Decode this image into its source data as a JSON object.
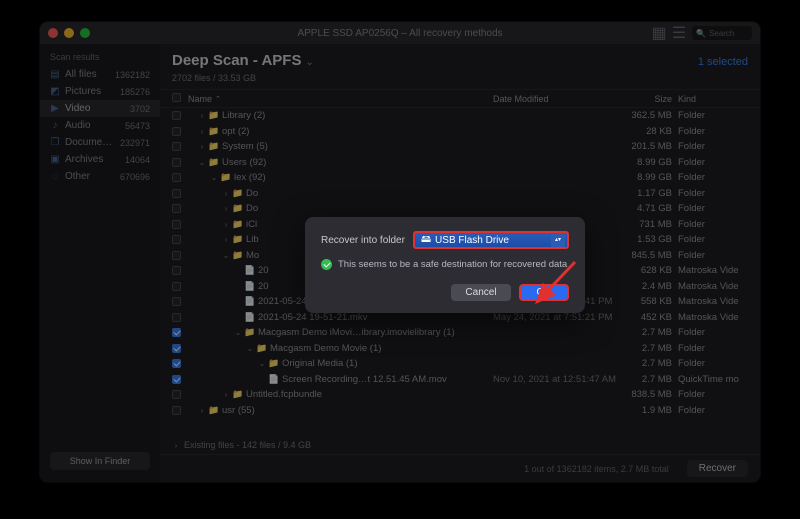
{
  "window": {
    "title": "APPLE SSD AP0256Q – All recovery methods",
    "search_placeholder": "Search"
  },
  "sidebar": {
    "header": "Scan results",
    "items": [
      {
        "icon": "files",
        "label": "All files",
        "count": "1362182"
      },
      {
        "icon": "pictures",
        "label": "Pictures",
        "count": "185276"
      },
      {
        "icon": "video",
        "label": "Video",
        "count": "3702",
        "selected": true
      },
      {
        "icon": "audio",
        "label": "Audio",
        "count": "56473"
      },
      {
        "icon": "documents",
        "label": "Documents",
        "count": "232971"
      },
      {
        "icon": "archives",
        "label": "Archives",
        "count": "14064"
      },
      {
        "icon": "other",
        "label": "Other",
        "count": "670696"
      }
    ],
    "show_in_finder": "Show In Finder"
  },
  "header": {
    "title": "Deep Scan - APFS",
    "subtitle": "2702 files / 33.53 GB",
    "selected": "1 selected"
  },
  "columns": {
    "name": "Name",
    "date": "Date Modified",
    "size": "Size",
    "kind": "Kind"
  },
  "files": [
    {
      "checked": false,
      "indent": 1,
      "disclosure": ">",
      "icon": "folder",
      "name": "Library (2)",
      "date": "",
      "size": "362.5 MB",
      "kind": "Folder"
    },
    {
      "checked": false,
      "indent": 1,
      "disclosure": ">",
      "icon": "folder",
      "name": "opt (2)",
      "date": "",
      "size": "28 KB",
      "kind": "Folder"
    },
    {
      "checked": false,
      "indent": 1,
      "disclosure": ">",
      "icon": "folder",
      "name": "System (5)",
      "date": "",
      "size": "201.5 MB",
      "kind": "Folder"
    },
    {
      "checked": false,
      "indent": 1,
      "disclosure": "v",
      "icon": "folder",
      "name": "Users (92)",
      "date": "",
      "size": "8.99 GB",
      "kind": "Folder"
    },
    {
      "checked": false,
      "indent": 2,
      "disclosure": "v",
      "icon": "folder",
      "name": "lex (92)",
      "date": "",
      "size": "8.99 GB",
      "kind": "Folder"
    },
    {
      "checked": false,
      "indent": 3,
      "disclosure": ">",
      "icon": "folder",
      "name": "Do",
      "date": "",
      "size": "1.17 GB",
      "kind": "Folder"
    },
    {
      "checked": false,
      "indent": 3,
      "disclosure": ">",
      "icon": "folder",
      "name": "Do",
      "date": "",
      "size": "4.71 GB",
      "kind": "Folder"
    },
    {
      "checked": false,
      "indent": 3,
      "disclosure": ">",
      "icon": "folder",
      "name": "iCl",
      "date": "",
      "size": "731 MB",
      "kind": "Folder"
    },
    {
      "checked": false,
      "indent": 3,
      "disclosure": ">",
      "icon": "folder",
      "name": "Lib",
      "date": "",
      "size": "1.53 GB",
      "kind": "Folder"
    },
    {
      "checked": false,
      "indent": 3,
      "disclosure": "v",
      "icon": "folder",
      "name": "Mo",
      "date": "",
      "size": "845.5 MB",
      "kind": "Folder"
    },
    {
      "checked": false,
      "indent": 4,
      "disclosure": "",
      "icon": "file",
      "name": "20",
      "date": "",
      "size": "628 KB",
      "kind": "Matroska Vide"
    },
    {
      "checked": false,
      "indent": 4,
      "disclosure": "",
      "icon": "file",
      "name": "20",
      "date": "",
      "size": "2.4 MB",
      "kind": "Matroska Vide"
    },
    {
      "checked": false,
      "indent": 4,
      "disclosure": "",
      "icon": "file",
      "name": "2021-05-24 19-47-41.mkv",
      "date": "May 24, 2021 at 7:47:41 PM",
      "size": "558 KB",
      "kind": "Matroska Vide"
    },
    {
      "checked": false,
      "indent": 4,
      "disclosure": "",
      "icon": "file",
      "name": "2021-05-24 19-51-21.mkv",
      "date": "May 24, 2021 at 7:51:21 PM",
      "size": "452 KB",
      "kind": "Matroska Vide"
    },
    {
      "checked": true,
      "indent": 4,
      "disclosure": "v",
      "icon": "folder",
      "name": "Macgasm Demo iMovi…ibrary.imovielibrary (1)",
      "date": "",
      "size": "2.7 MB",
      "kind": "Folder"
    },
    {
      "checked": true,
      "indent": 5,
      "disclosure": "v",
      "icon": "folder",
      "name": "Macgasm Demo Movie (1)",
      "date": "",
      "size": "2.7 MB",
      "kind": "Folder"
    },
    {
      "checked": true,
      "indent": 6,
      "disclosure": "v",
      "icon": "folder",
      "name": "Original Media (1)",
      "date": "",
      "size": "2.7 MB",
      "kind": "Folder"
    },
    {
      "checked": true,
      "indent": 6,
      "disclosure": "",
      "icon": "file",
      "name": "  Screen Recording…t 12.51.45 AM.mov",
      "date": "Nov 10, 2021 at 12:51:47 AM",
      "size": "2.7 MB",
      "kind": "QuickTime mo"
    },
    {
      "checked": false,
      "indent": 3,
      "disclosure": ">",
      "icon": "folder",
      "name": "Untitled.fcpbundle",
      "date": "",
      "size": "838.5 MB",
      "kind": "Folder"
    },
    {
      "checked": false,
      "indent": 1,
      "disclosure": ">",
      "icon": "folder",
      "name": "usr (55)",
      "date": "",
      "size": "1.9 MB",
      "kind": "Folder"
    }
  ],
  "existing": {
    "label": "Existing files - 142 files / 9.4 GB"
  },
  "footer": {
    "summary": "1 out of 1362182 items, 2.7 MB total",
    "recover": "Recover"
  },
  "dialog": {
    "label": "Recover into folder",
    "destination": "USB Flash Drive",
    "safe_text": "This seems to be a safe destination for recovered data",
    "cancel": "Cancel",
    "ok": "OK"
  }
}
